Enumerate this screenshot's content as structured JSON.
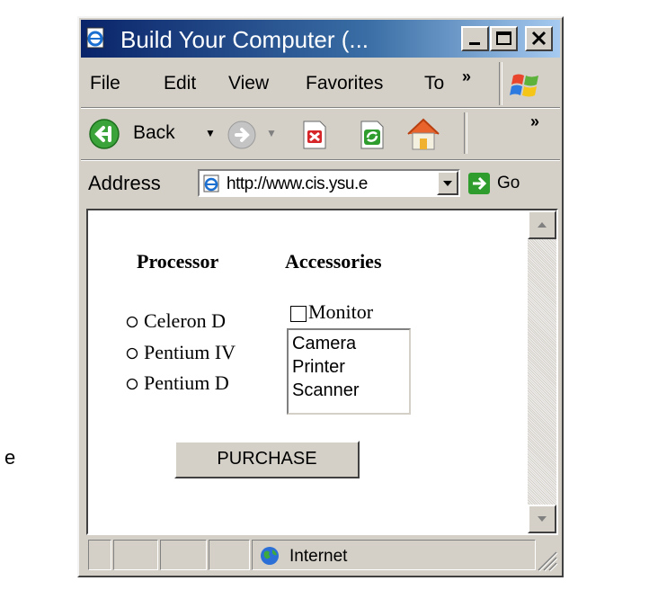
{
  "window": {
    "title": "Build Your Computer (...",
    "caption_buttons": [
      "minimize",
      "maximize",
      "close"
    ]
  },
  "menu": {
    "items": [
      "File",
      "Edit",
      "View",
      "Favorites",
      "To"
    ],
    "overflow": "»"
  },
  "toolbar": {
    "back_label": "Back",
    "overflow": "»",
    "icons": [
      "back-icon",
      "forward-icon",
      "stop-icon",
      "refresh-icon",
      "home-icon"
    ]
  },
  "address": {
    "label": "Address",
    "url": "http://www.cis.ysu.e",
    "go_label": "Go"
  },
  "form": {
    "processor_heading": "Processor",
    "accessories_heading": "Accessories",
    "processors": [
      "Celeron D",
      "Pentium IV",
      "Pentium D"
    ],
    "checkbox_label": "Monitor",
    "list_options": [
      "Camera",
      "Printer",
      "Scanner"
    ],
    "purchase_label": "PURCHASE"
  },
  "status": {
    "zone": "Internet"
  },
  "stray_text": "e",
  "colors": {
    "titlebar_start": "#0a246a",
    "titlebar_end": "#a6caf0",
    "chrome": "#d4d0c8"
  }
}
